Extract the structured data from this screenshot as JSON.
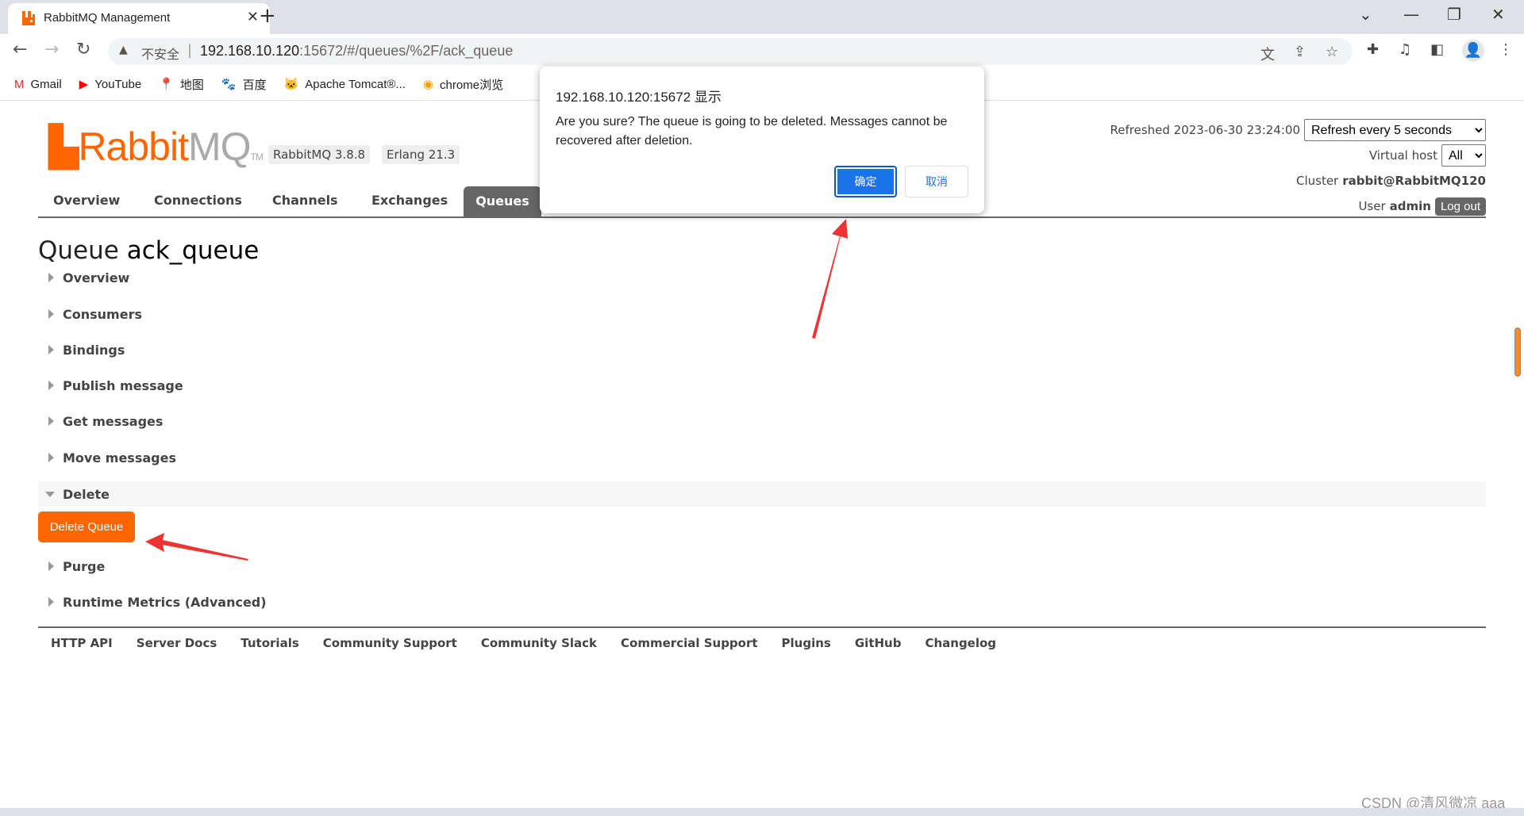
{
  "browser": {
    "tab_title": "RabbitMQ Management",
    "insecure_label": "不安全",
    "url_host": "192.168.10.120",
    "url_rest": ":15672/#/queues/%2F/ack_queue",
    "bookmarks": [
      {
        "label": "Gmail",
        "icon": "gmail-icon"
      },
      {
        "label": "YouTube",
        "icon": "youtube-icon"
      },
      {
        "label": "地图",
        "icon": "maps-icon"
      },
      {
        "label": "百度",
        "icon": "baidu-icon"
      },
      {
        "label": "Apache Tomcat®...",
        "icon": "tomcat-icon"
      },
      {
        "label": "chrome浏览",
        "icon": "chrome-ext-icon"
      }
    ]
  },
  "header": {
    "logo_rabbit": "Rabbit",
    "logo_mq": "MQ",
    "logo_tm": "TM",
    "version_badge": "RabbitMQ 3.8.8",
    "erlang_badge": "Erlang 21.3",
    "refreshed": "Refreshed 2023-06-30 23:24:00",
    "refresh_select": "Refresh every 5 seconds",
    "vhost_label": "Virtual host",
    "vhost_select": "All",
    "cluster_label": "Cluster",
    "cluster_name": "rabbit@RabbitMQ120",
    "user_label": "User",
    "user_name": "admin",
    "logout": "Log out"
  },
  "nav": {
    "tabs": [
      "Overview",
      "Connections",
      "Channels",
      "Exchanges",
      "Queues"
    ],
    "active": "Queues"
  },
  "page": {
    "title_prefix": "Queue",
    "queue_name": "ack_queue",
    "sections": [
      "Overview",
      "Consumers",
      "Bindings",
      "Publish message",
      "Get messages",
      "Move messages",
      "Delete",
      "Purge",
      "Runtime Metrics (Advanced)"
    ],
    "expanded_section": "Delete",
    "delete_button": "Delete Queue"
  },
  "footer": {
    "links": [
      "HTTP API",
      "Server Docs",
      "Tutorials",
      "Community Support",
      "Community Slack",
      "Commercial Support",
      "Plugins",
      "GitHub",
      "Changelog"
    ]
  },
  "dialog": {
    "title": "192.168.10.120:15672 显示",
    "message": "Are you sure? The queue is going to be deleted. Messages cannot be recovered after deletion.",
    "ok": "确定",
    "cancel": "取消"
  },
  "watermark": "CSDN @清风微凉 aaa",
  "colors": {
    "brand": "#ff6600",
    "dialog_ok": "#1a73e8",
    "annotation_arrow": "#ee3333"
  }
}
